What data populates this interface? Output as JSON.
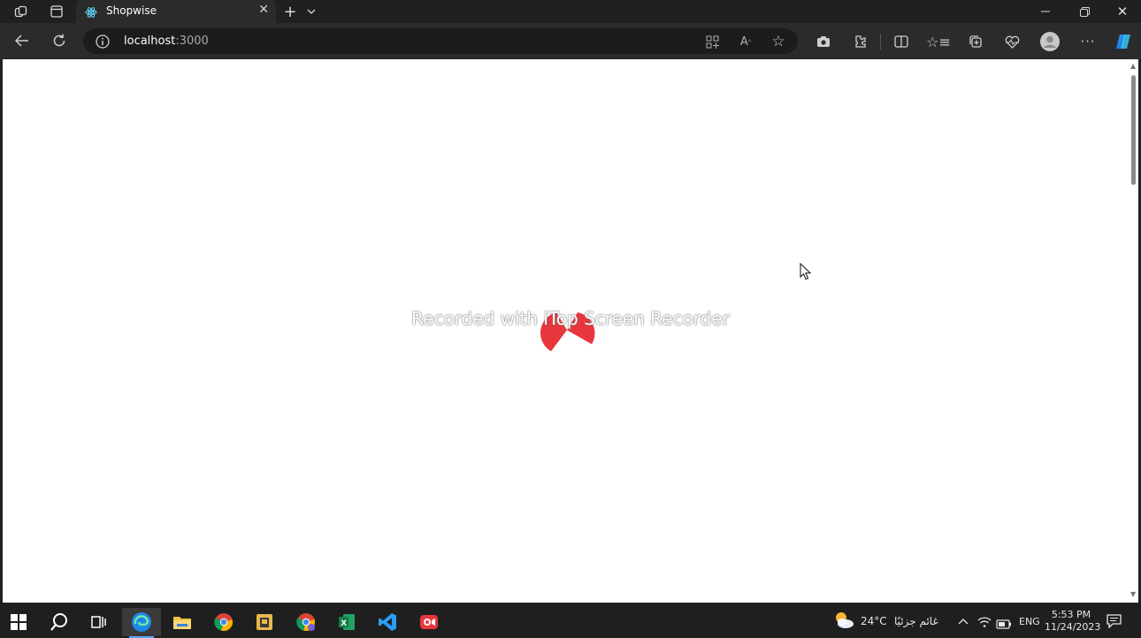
{
  "browser": {
    "tab_title": "Shopwise",
    "url_host": "localhost",
    "url_port": ":3000"
  },
  "watermark": {
    "text": "Recorded with iTop Screen Recorder"
  },
  "taskbar": {
    "weather_temp": "24°C",
    "weather_text": "غائم جزئيًا",
    "language": "ENG",
    "time": "5:53 PM",
    "date": "11/24/2023"
  },
  "colors": {
    "chrome_dark": "#202020",
    "toolbar": "#2b2b2b",
    "spinner": "#e8363d",
    "edge_blue": "#1e88e5"
  },
  "icons": [
    "workspaces-icon",
    "tab-actions-icon",
    "react-favicon",
    "close-icon",
    "new-tab-icon",
    "chevron-down-icon",
    "minimize-icon",
    "restore-icon",
    "back-icon",
    "refresh-icon",
    "info-icon",
    "app-available-icon",
    "read-aloud-icon",
    "favorite-star-icon",
    "screenshot-icon",
    "extensions-icon",
    "split-screen-icon",
    "favorites-icon",
    "collections-icon",
    "performance-icon",
    "profile-avatar",
    "more-icon",
    "copilot-icon",
    "windows-start-icon",
    "search-icon",
    "task-view-icon",
    "edge-icon",
    "file-explorer-icon",
    "chrome-icon",
    "excel-icon",
    "vscode-icon",
    "itop-recorder-icon",
    "notification-icon"
  ]
}
